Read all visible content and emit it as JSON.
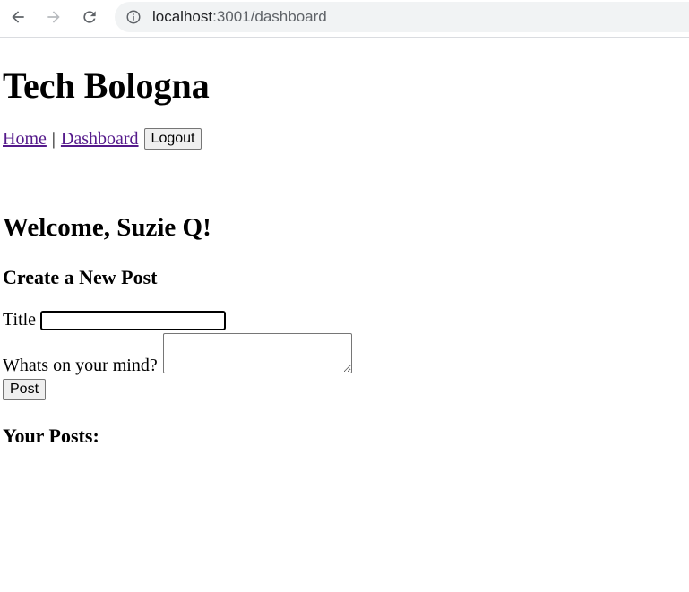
{
  "browser": {
    "url_host": "localhost",
    "url_path": ":3001/dashboard",
    "icons": {
      "back": "arrow-left-icon",
      "forward": "arrow-right-icon",
      "reload": "reload-icon",
      "info": "info-icon"
    }
  },
  "site": {
    "title": "Tech Bologna"
  },
  "nav": {
    "home_label": "Home",
    "separator": "|",
    "dashboard_label": "Dashboard",
    "logout_label": "Logout"
  },
  "welcome": "Welcome, Suzie Q!",
  "create_post": {
    "heading": "Create a New Post",
    "title_label": "Title",
    "title_value": "",
    "body_label": "Whats on your mind?",
    "body_value": "",
    "submit_label": "Post"
  },
  "posts": {
    "heading": "Your Posts:"
  },
  "colors": {
    "link_visited": "#551a8b",
    "chrome_border": "#dadce0",
    "omnibox_bg": "#f1f3f4"
  }
}
